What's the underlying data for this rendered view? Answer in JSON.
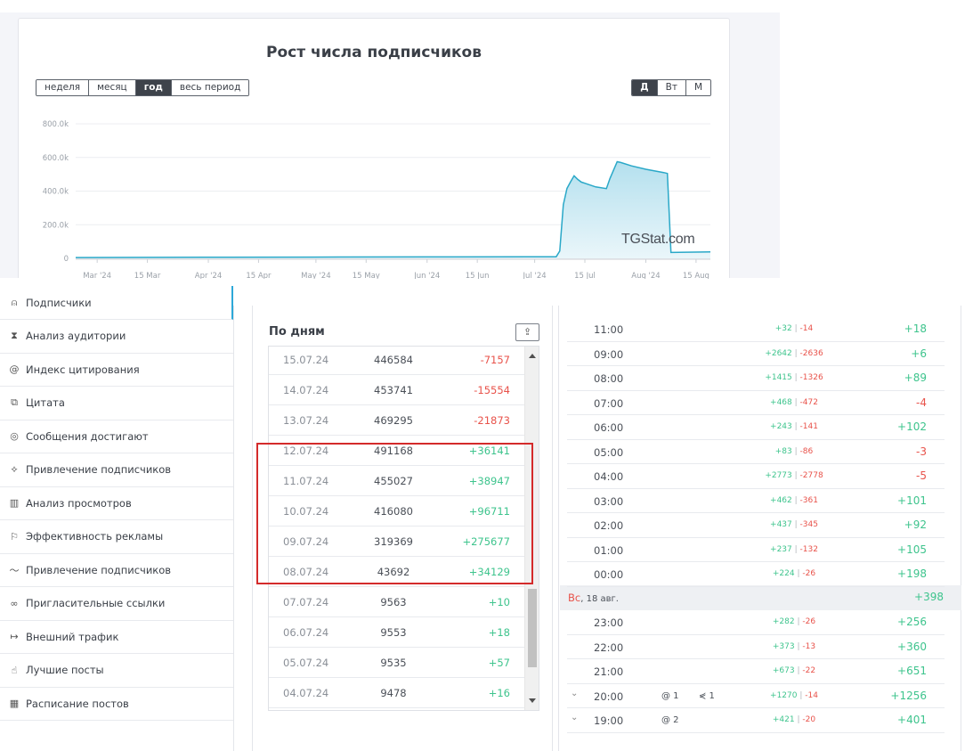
{
  "chart": {
    "title": "Рост числа подписчиков",
    "period_buttons": [
      "неделя",
      "месяц",
      "год",
      "весь период"
    ],
    "period_active": "год",
    "interval_buttons": [
      "Д",
      "Вт",
      "М"
    ],
    "interval_active": "Д",
    "watermark": "TGStat.com",
    "colors": {
      "line": "#2aa8c8",
      "fill_top": "#b4e0ee",
      "fill_bottom": "#eaf6fa"
    }
  },
  "chart_data": {
    "type": "area",
    "title": "Рост числа подписчиков",
    "xlabel": "",
    "ylabel": "",
    "ylim": [
      0,
      800000
    ],
    "y_ticks": [
      "0",
      "200.0k",
      "400.0k",
      "600.0k",
      "800.0k"
    ],
    "x_ticks": [
      "Mar '24",
      "15 Mar",
      "Apr '24",
      "15 Apr",
      "May '24",
      "15 May",
      "Jun '24",
      "15 Jun",
      "Jul '24",
      "15 Jul",
      "Aug '24",
      "15 Aug"
    ],
    "grid": true,
    "x": [
      "2024-02-24",
      "2024-03-31",
      "2024-04-30",
      "2024-05-31",
      "2024-06-30",
      "2024-07-06",
      "2024-07-07",
      "2024-07-08",
      "2024-07-09",
      "2024-07-10",
      "2024-07-11",
      "2024-07-12",
      "2024-07-13",
      "2024-07-14",
      "2024-07-15",
      "2024-07-18",
      "2024-07-21",
      "2024-07-22",
      "2024-07-24",
      "2024-07-25",
      "2024-07-28",
      "2024-08-01",
      "2024-08-06",
      "2024-08-07",
      "2024-08-08",
      "2024-08-19"
    ],
    "y": [
      5000,
      6500,
      7500,
      8500,
      9200,
      9478,
      9563,
      43692,
      319369,
      416080,
      455027,
      491168,
      469295,
      453741,
      446584,
      425000,
      415000,
      475000,
      575000,
      570000,
      550000,
      530000,
      510000,
      505000,
      35000,
      38000
    ]
  },
  "sidebar": {
    "items": [
      {
        "icon": "⍝",
        "label": "Подписчики"
      },
      {
        "icon": "⧗",
        "label": "Анализ аудитории"
      },
      {
        "icon": "@",
        "label": "Индекс цитирования"
      },
      {
        "icon": "⧉",
        "label": "Цитата"
      },
      {
        "icon": "◎",
        "label": "Сообщения достигают"
      },
      {
        "icon": "⟡",
        "label": "Привлечение подписчиков"
      },
      {
        "icon": "▥",
        "label": "Анализ просмотров"
      },
      {
        "icon": "⚐",
        "label": "Эффективность рекламы"
      },
      {
        "icon": "〜",
        "label": "Привлечение подписчиков"
      },
      {
        "icon": "∞",
        "label": "Пригласительные ссылки"
      },
      {
        "icon": "↦",
        "label": "Внешний трафик"
      },
      {
        "icon": "☝",
        "label": "Лучшие посты"
      },
      {
        "icon": "▦",
        "label": "Расписание постов"
      }
    ]
  },
  "days": {
    "title": "По дням",
    "export_icon": "⇪",
    "rows": [
      {
        "date": "15.07.24",
        "value": "446584",
        "change": "-7157"
      },
      {
        "date": "14.07.24",
        "value": "453741",
        "change": "-15554"
      },
      {
        "date": "13.07.24",
        "value": "469295",
        "change": "-21873"
      },
      {
        "date": "12.07.24",
        "value": "491168",
        "change": "+36141"
      },
      {
        "date": "11.07.24",
        "value": "455027",
        "change": "+38947"
      },
      {
        "date": "10.07.24",
        "value": "416080",
        "change": "+96711"
      },
      {
        "date": "09.07.24",
        "value": "319369",
        "change": "+275677"
      },
      {
        "date": "08.07.24",
        "value": "43692",
        "change": "+34129"
      },
      {
        "date": "07.07.24",
        "value": "9563",
        "change": "+10"
      },
      {
        "date": "06.07.24",
        "value": "9553",
        "change": "+18"
      },
      {
        "date": "05.07.24",
        "value": "9535",
        "change": "+57"
      },
      {
        "date": "04.07.24",
        "value": "9478",
        "change": "+16"
      }
    ]
  },
  "hours": {
    "rows_before": [
      {
        "time": "11:00",
        "plus": "+32",
        "minus": "-14",
        "net": "+18"
      },
      {
        "time": "09:00",
        "plus": "+2642",
        "minus": "-2636",
        "net": "+6"
      },
      {
        "time": "08:00",
        "plus": "+1415",
        "minus": "-1326",
        "net": "+89"
      },
      {
        "time": "07:00",
        "plus": "+468",
        "minus": "-472",
        "net": "-4"
      },
      {
        "time": "06:00",
        "plus": "+243",
        "minus": "-141",
        "net": "+102"
      },
      {
        "time": "05:00",
        "plus": "+83",
        "minus": "-86",
        "net": "-3"
      },
      {
        "time": "04:00",
        "plus": "+2773",
        "minus": "-2778",
        "net": "-5"
      },
      {
        "time": "03:00",
        "plus": "+462",
        "minus": "-361",
        "net": "+101"
      },
      {
        "time": "02:00",
        "plus": "+437",
        "minus": "-345",
        "net": "+92"
      },
      {
        "time": "01:00",
        "plus": "+237",
        "minus": "-132",
        "net": "+105"
      },
      {
        "time": "00:00",
        "plus": "+224",
        "minus": "-26",
        "net": "+198"
      }
    ],
    "day_header": {
      "weekday": "Вс",
      "date": ", 18 авг.",
      "net": "+398"
    },
    "rows_after": [
      {
        "time": "23:00",
        "plus": "+282",
        "minus": "-26",
        "net": "+256"
      },
      {
        "time": "22:00",
        "plus": "+373",
        "minus": "-13",
        "net": "+360"
      },
      {
        "time": "21:00",
        "plus": "+673",
        "minus": "-22",
        "net": "+651"
      },
      {
        "time": "20:00",
        "plus": "+1270",
        "minus": "-14",
        "net": "+1256",
        "expand": "⌄",
        "mentions": "@ 1",
        "shares": "⋞ 1"
      },
      {
        "time": "19:00",
        "plus": "+421",
        "minus": "-20",
        "net": "+401",
        "expand": "⌄",
        "mentions": "@ 2",
        "shares": ""
      }
    ]
  }
}
